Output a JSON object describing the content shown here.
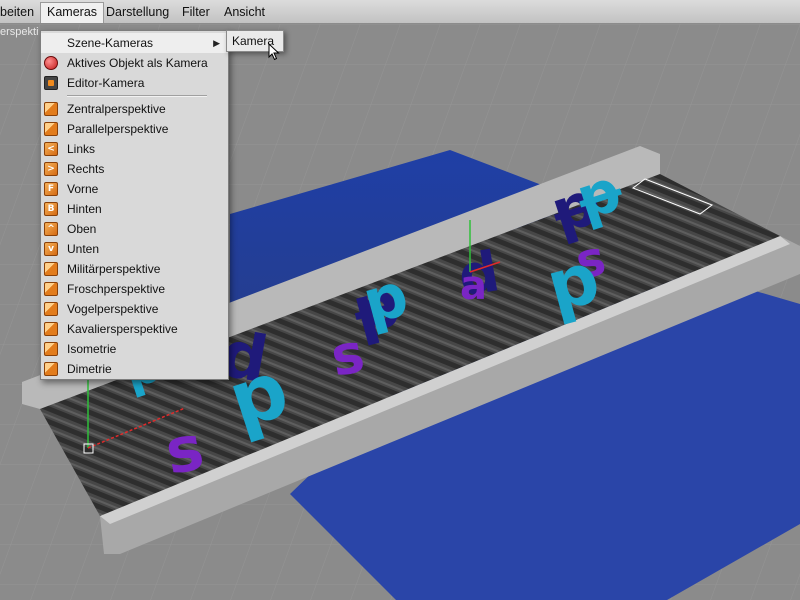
{
  "menubar": {
    "items": [
      {
        "label": "beiten"
      },
      {
        "label": "Kameras"
      },
      {
        "label": "Darstellung"
      },
      {
        "label": "Filter"
      },
      {
        "label": "Ansicht"
      }
    ]
  },
  "viewport": {
    "perspective_label": "erspekti"
  },
  "kameras_menu": {
    "items": [
      {
        "label": "Szene-Kameras",
        "icon": "none",
        "has_submenu": true
      },
      {
        "label": "Aktives Objekt als Kamera",
        "icon": "object-camera-icon"
      },
      {
        "label": "Editor-Kamera",
        "icon": "editor-camera-icon"
      },
      {
        "label": "Zentralperspektive",
        "icon": "perspective-cube-icon"
      },
      {
        "label": "Parallelperspektive",
        "icon": "parallel-cube-icon"
      },
      {
        "label": "Links",
        "icon": "left-icon",
        "glyph": "<"
      },
      {
        "label": "Rechts",
        "icon": "right-icon",
        "glyph": ">"
      },
      {
        "label": "Vorne",
        "icon": "front-icon",
        "glyph": "F"
      },
      {
        "label": "Hinten",
        "icon": "back-icon",
        "glyph": "B"
      },
      {
        "label": "Oben",
        "icon": "top-icon",
        "glyph": "^"
      },
      {
        "label": "Unten",
        "icon": "bottom-icon",
        "glyph": "v"
      },
      {
        "label": "Militärperspektive",
        "icon": "military-icon"
      },
      {
        "label": "Froschperspektive",
        "icon": "frog-icon"
      },
      {
        "label": "Vogelperspektive",
        "icon": "bird-icon"
      },
      {
        "label": "Kavaliersperspektive",
        "icon": "cavalier-icon"
      },
      {
        "label": "Isometrie",
        "icon": "isometric-icon"
      },
      {
        "label": "Dimetrie",
        "icon": "dimetric-icon"
      }
    ]
  },
  "submenu": {
    "items": [
      {
        "label": "Kamera"
      }
    ]
  },
  "colors": {
    "menu_bg": "#d9d9d9",
    "menu_highlight": "#eeeeee",
    "icon_orange": "#e27c1c",
    "letter_cyan": "#1aa4c9",
    "letter_purple": "#6a1fb3",
    "letter_navy": "#1f1a7a",
    "plane_blue": "#1f3ea0"
  }
}
